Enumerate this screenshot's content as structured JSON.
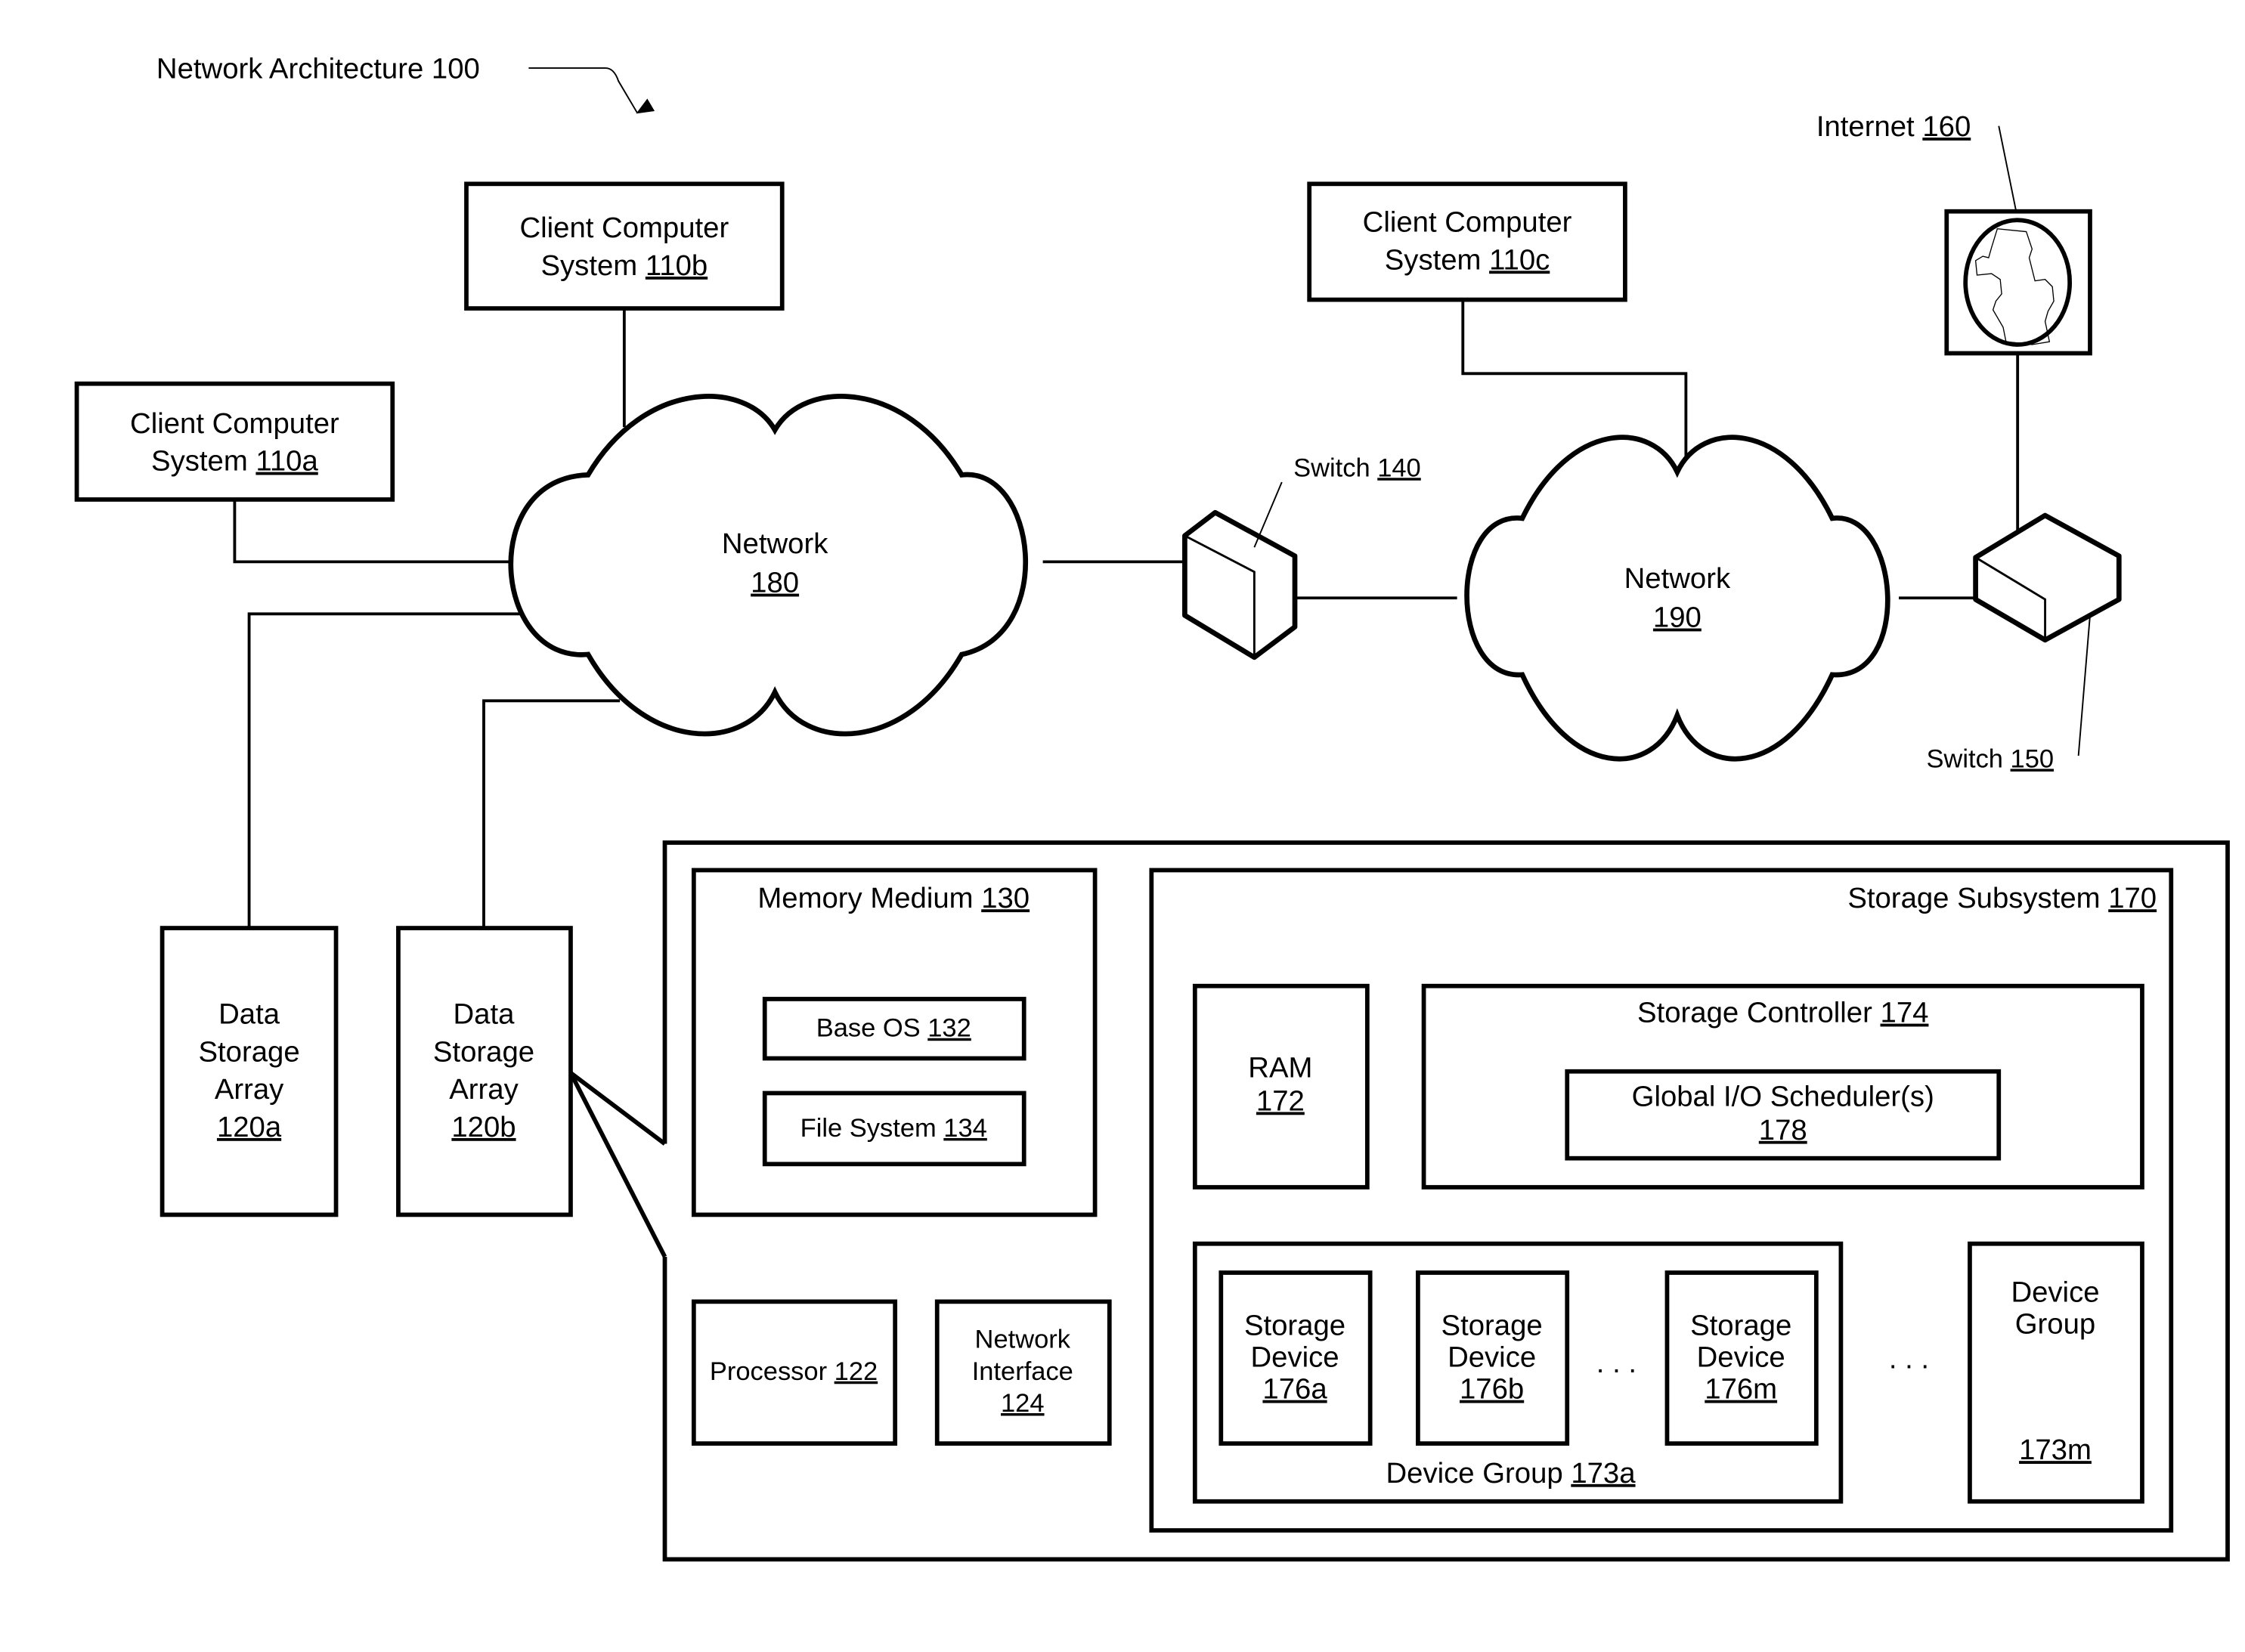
{
  "title": {
    "text": "Network Architecture",
    "ref": "100"
  },
  "clients": [
    {
      "line1": "Client Computer",
      "line2": "System",
      "ref": "110a"
    },
    {
      "line1": "Client Computer",
      "line2": "System",
      "ref": "110b"
    },
    {
      "line1": "Client Computer",
      "line2": "System",
      "ref": "110c"
    }
  ],
  "networks": [
    {
      "label": "Network",
      "ref": "180"
    },
    {
      "label": "Network",
      "ref": "190"
    }
  ],
  "switches": [
    {
      "label": "Switch",
      "ref": "140"
    },
    {
      "label": "Switch",
      "ref": "150"
    }
  ],
  "internet": {
    "label": "Internet",
    "ref": "160"
  },
  "data_storage_arrays": [
    {
      "line1": "Data",
      "line2": "Storage",
      "line3": "Array",
      "ref": "120a"
    },
    {
      "line1": "Data",
      "line2": "Storage",
      "line3": "Array",
      "ref": "120b"
    }
  ],
  "memory_medium": {
    "label": "Memory Medium",
    "ref": "130",
    "base_os": {
      "label": "Base OS",
      "ref": "132"
    },
    "file_system": {
      "label": "File System",
      "ref": "134"
    }
  },
  "processor": {
    "label": "Processor",
    "ref": "122"
  },
  "network_interface": {
    "line1": "Network",
    "line2": "Interface",
    "ref": "124"
  },
  "storage_subsystem": {
    "label": "Storage Subsystem",
    "ref": "170",
    "ram": {
      "label": "RAM",
      "ref": "172"
    },
    "storage_controller": {
      "label": "Storage Controller",
      "ref": "174",
      "scheduler": {
        "label": "Global I/O Scheduler(s)",
        "ref": "178"
      }
    },
    "device_group_a": {
      "label": "Device Group",
      "ref": "173a",
      "devices": [
        {
          "line1": "Storage",
          "line2": "Device",
          "ref": "176a"
        },
        {
          "line1": "Storage",
          "line2": "Device",
          "ref": "176b"
        },
        {
          "line1": "Storage",
          "line2": "Device",
          "ref": "176m"
        }
      ]
    },
    "device_group_m": {
      "line1": "Device",
      "line2": "Group",
      "ref": "173m"
    },
    "ellipsis": ". . ."
  }
}
